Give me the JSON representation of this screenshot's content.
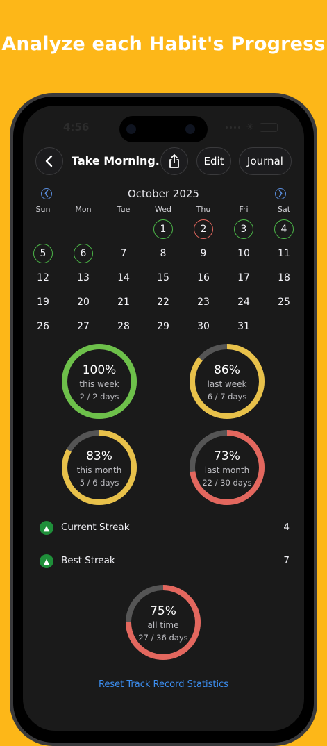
{
  "headline": "Analyze each Habit's Progress",
  "status_bar": {
    "time": "4:56"
  },
  "nav": {
    "back_icon": "chevron-left-icon",
    "title": "Take Morning...",
    "share_icon": "share-icon",
    "edit_label": "Edit",
    "journal_label": "Journal"
  },
  "calendar": {
    "month_title": "October 2025",
    "prev_icon": "chevron-left-circle-icon",
    "next_icon": "chevron-right-circle-icon",
    "weekdays": [
      "Sun",
      "Mon",
      "Tue",
      "Wed",
      "Thu",
      "Fri",
      "Sat"
    ],
    "weeks": [
      [
        null,
        null,
        null,
        {
          "day": "1",
          "status": "done"
        },
        {
          "day": "2",
          "status": "missed"
        },
        {
          "day": "3",
          "status": "done"
        },
        {
          "day": "4",
          "status": "done"
        }
      ],
      [
        {
          "day": "5",
          "status": "done"
        },
        {
          "day": "6",
          "status": "done"
        },
        {
          "day": "7"
        },
        {
          "day": "8"
        },
        {
          "day": "9"
        },
        {
          "day": "10"
        },
        {
          "day": "11"
        }
      ],
      [
        {
          "day": "12"
        },
        {
          "day": "13"
        },
        {
          "day": "14"
        },
        {
          "day": "15"
        },
        {
          "day": "16"
        },
        {
          "day": "17"
        },
        {
          "day": "18"
        }
      ],
      [
        {
          "day": "19"
        },
        {
          "day": "20"
        },
        {
          "day": "21"
        },
        {
          "day": "22"
        },
        {
          "day": "23"
        },
        {
          "day": "24"
        },
        {
          "day": "25"
        }
      ],
      [
        {
          "day": "26"
        },
        {
          "day": "27"
        },
        {
          "day": "28"
        },
        {
          "day": "29"
        },
        {
          "day": "30"
        },
        {
          "day": "31"
        },
        null
      ]
    ]
  },
  "stats": [
    {
      "percent": "100%",
      "fraction": 1.0,
      "label": "this week",
      "count": "2 / 2 days",
      "color": "#6DC04A"
    },
    {
      "percent": "86%",
      "fraction": 0.86,
      "label": "last week",
      "count": "6 / 7 days",
      "color": "#E8C14A"
    },
    {
      "percent": "83%",
      "fraction": 0.83,
      "label": "this month",
      "count": "5 / 6 days",
      "color": "#E8C14A"
    },
    {
      "percent": "73%",
      "fraction": 0.73,
      "label": "last month",
      "count": "22 / 30 days",
      "color": "#E3675E"
    }
  ],
  "streaks": {
    "current_label": "Current Streak",
    "current_value": "4",
    "best_label": "Best Streak",
    "best_value": "7",
    "icon": "flame-icon"
  },
  "all_time": {
    "percent": "75%",
    "fraction": 0.75,
    "label": "all time",
    "count": "27 / 36 days",
    "color": "#E3675E"
  },
  "reset_label": "Reset Track Record Statistics",
  "colors": {
    "background": "#FDB718",
    "screen": "#1a1a1a",
    "done": "#4CB848",
    "missed": "#E3675E",
    "link": "#3c8ef0",
    "ring_track": "#555555"
  }
}
